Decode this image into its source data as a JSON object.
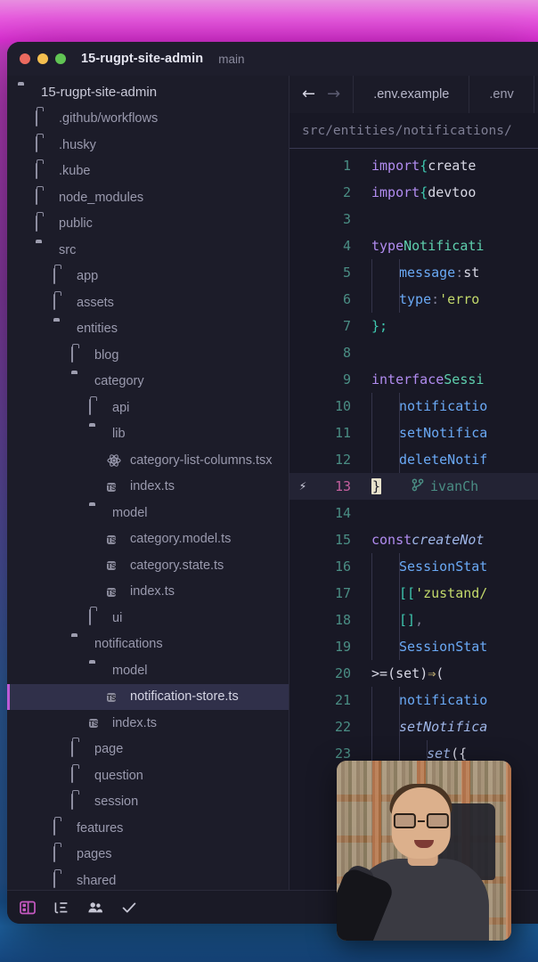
{
  "window": {
    "title": "15-rugpt-site-admin",
    "branch": "main",
    "traffic_lights": [
      "close",
      "minimize",
      "zoom"
    ]
  },
  "sidebar": {
    "items": [
      {
        "label": "15-rugpt-site-admin",
        "icon": "folder-open-icon",
        "depth": 0,
        "kind": "root",
        "selected": false
      },
      {
        "label": ".github/workflows",
        "icon": "folder-icon",
        "depth": 1,
        "kind": "folder",
        "selected": false
      },
      {
        "label": ".husky",
        "icon": "folder-icon",
        "depth": 1,
        "kind": "folder",
        "selected": false
      },
      {
        "label": ".kube",
        "icon": "folder-icon",
        "depth": 1,
        "kind": "folder",
        "selected": false
      },
      {
        "label": "node_modules",
        "icon": "folder-icon",
        "depth": 1,
        "kind": "folder",
        "selected": false
      },
      {
        "label": "public",
        "icon": "folder-icon",
        "depth": 1,
        "kind": "folder",
        "selected": false
      },
      {
        "label": "src",
        "icon": "folder-open-icon",
        "depth": 1,
        "kind": "folder-open",
        "selected": false
      },
      {
        "label": "app",
        "icon": "folder-icon",
        "depth": 2,
        "kind": "folder",
        "selected": false
      },
      {
        "label": "assets",
        "icon": "folder-icon",
        "depth": 2,
        "kind": "folder",
        "selected": false
      },
      {
        "label": "entities",
        "icon": "folder-open-icon",
        "depth": 2,
        "kind": "folder-open",
        "selected": false
      },
      {
        "label": "blog",
        "icon": "folder-icon",
        "depth": 3,
        "kind": "folder",
        "selected": false
      },
      {
        "label": "category",
        "icon": "folder-open-icon",
        "depth": 3,
        "kind": "folder-open",
        "selected": false
      },
      {
        "label": "api",
        "icon": "folder-icon",
        "depth": 4,
        "kind": "folder",
        "selected": false
      },
      {
        "label": "lib",
        "icon": "folder-open-icon",
        "depth": 4,
        "kind": "folder-open",
        "selected": false
      },
      {
        "label": "category-list-columns.tsx",
        "icon": "react-file-icon",
        "depth": 5,
        "kind": "tsx",
        "selected": false
      },
      {
        "label": "index.ts",
        "icon": "typescript-file-icon",
        "depth": 5,
        "kind": "ts",
        "selected": false
      },
      {
        "label": "model",
        "icon": "folder-open-icon",
        "depth": 4,
        "kind": "folder-open",
        "selected": false
      },
      {
        "label": "category.model.ts",
        "icon": "typescript-file-icon",
        "depth": 5,
        "kind": "ts",
        "selected": false
      },
      {
        "label": "category.state.ts",
        "icon": "typescript-file-icon",
        "depth": 5,
        "kind": "ts",
        "selected": false
      },
      {
        "label": "index.ts",
        "icon": "typescript-file-icon",
        "depth": 5,
        "kind": "ts",
        "selected": false
      },
      {
        "label": "ui",
        "icon": "folder-icon",
        "depth": 4,
        "kind": "folder",
        "selected": false
      },
      {
        "label": "notifications",
        "icon": "folder-open-icon",
        "depth": 3,
        "kind": "folder-open",
        "selected": false
      },
      {
        "label": "model",
        "icon": "folder-open-icon",
        "depth": 4,
        "kind": "folder-open",
        "selected": false
      },
      {
        "label": "notification-store.ts",
        "icon": "typescript-file-icon",
        "depth": 5,
        "kind": "ts",
        "selected": true
      },
      {
        "label": "index.ts",
        "icon": "typescript-file-icon",
        "depth": 4,
        "kind": "ts",
        "selected": false
      },
      {
        "label": "page",
        "icon": "folder-icon",
        "depth": 3,
        "kind": "folder",
        "selected": false
      },
      {
        "label": "question",
        "icon": "folder-icon",
        "depth": 3,
        "kind": "folder",
        "selected": false
      },
      {
        "label": "session",
        "icon": "folder-icon",
        "depth": 3,
        "kind": "folder",
        "selected": false
      },
      {
        "label": "features",
        "icon": "folder-icon",
        "depth": 2,
        "kind": "folder",
        "selected": false
      },
      {
        "label": "pages",
        "icon": "folder-icon",
        "depth": 2,
        "kind": "folder",
        "selected": false
      },
      {
        "label": "shared",
        "icon": "folder-icon",
        "depth": 2,
        "kind": "folder",
        "selected": false
      }
    ]
  },
  "statusbar": {
    "icons": [
      {
        "name": "toggle-sidebar-icon",
        "color": "#c659c2"
      },
      {
        "name": "outline-list-icon",
        "color": "#c6c6d4"
      },
      {
        "name": "collaborators-icon",
        "color": "#c6c6d4"
      },
      {
        "name": "checkmark-icon",
        "color": "#c6c6d4"
      }
    ]
  },
  "editor": {
    "nav": {
      "back": "←",
      "forward": "→"
    },
    "tabs": [
      {
        "label": ".env.example",
        "active": true
      },
      {
        "label": ".env",
        "active": false
      }
    ],
    "breadcrumb": "src/entities/notifications/",
    "active_line": 13,
    "cursor_char": "}",
    "blame": {
      "author": "ivanCh",
      "icon": "git-branch-icon"
    },
    "lines": [
      {
        "n": 1,
        "indent": 0,
        "tokens": [
          {
            "t": "import",
            "c": "kw"
          },
          {
            "t": " ",
            "c": "plain"
          },
          {
            "t": "{",
            "c": "brace"
          },
          {
            "t": " ",
            "c": "plain"
          },
          {
            "t": "create",
            "c": "plain"
          }
        ]
      },
      {
        "n": 2,
        "indent": 0,
        "tokens": [
          {
            "t": "import",
            "c": "kw"
          },
          {
            "t": " ",
            "c": "plain"
          },
          {
            "t": "{",
            "c": "brace"
          },
          {
            "t": " ",
            "c": "plain"
          },
          {
            "t": "devtoo",
            "c": "plain"
          }
        ]
      },
      {
        "n": 3,
        "indent": 0,
        "tokens": []
      },
      {
        "n": 4,
        "indent": 0,
        "tokens": [
          {
            "t": "type",
            "c": "kw"
          },
          {
            "t": " ",
            "c": "plain"
          },
          {
            "t": "Notificati",
            "c": "type"
          }
        ]
      },
      {
        "n": 5,
        "indent": 1,
        "tokens": [
          {
            "t": "message",
            "c": "prop"
          },
          {
            "t": ":",
            "c": "punct"
          },
          {
            "t": " st",
            "c": "plain"
          }
        ]
      },
      {
        "n": 6,
        "indent": 1,
        "tokens": [
          {
            "t": "type",
            "c": "prop"
          },
          {
            "t": ":",
            "c": "punct"
          },
          {
            "t": " ",
            "c": "plain"
          },
          {
            "t": "'erro",
            "c": "str"
          }
        ]
      },
      {
        "n": 7,
        "indent": 0,
        "tokens": [
          {
            "t": "};",
            "c": "brace"
          }
        ]
      },
      {
        "n": 8,
        "indent": 0,
        "tokens": []
      },
      {
        "n": 9,
        "indent": 0,
        "tokens": [
          {
            "t": "interface",
            "c": "kw"
          },
          {
            "t": " ",
            "c": "plain"
          },
          {
            "t": "Sessi",
            "c": "type"
          }
        ]
      },
      {
        "n": 10,
        "indent": 1,
        "tokens": [
          {
            "t": "notificatio",
            "c": "prop"
          }
        ]
      },
      {
        "n": 11,
        "indent": 1,
        "tokens": [
          {
            "t": "setNotifica",
            "c": "prop"
          }
        ]
      },
      {
        "n": 12,
        "indent": 1,
        "tokens": [
          {
            "t": "deleteNotif",
            "c": "prop"
          }
        ]
      },
      {
        "n": 13,
        "indent": 0,
        "tokens": [],
        "cursor": true,
        "blame": true
      },
      {
        "n": 14,
        "indent": 0,
        "tokens": []
      },
      {
        "n": 15,
        "indent": 0,
        "tokens": [
          {
            "t": "const",
            "c": "kw"
          },
          {
            "t": " ",
            "c": "plain"
          },
          {
            "t": "createNot",
            "c": "ital"
          }
        ]
      },
      {
        "n": 16,
        "indent": 1,
        "tokens": [
          {
            "t": "SessionStat",
            "c": "prop"
          }
        ]
      },
      {
        "n": 17,
        "indent": 1,
        "tokens": [
          {
            "t": "[[",
            "c": "brace"
          },
          {
            "t": "'zustand/",
            "c": "str"
          }
        ]
      },
      {
        "n": 18,
        "indent": 1,
        "tokens": [
          {
            "t": "[]",
            "c": "brace"
          },
          {
            "t": ",",
            "c": "punct"
          }
        ]
      },
      {
        "n": 19,
        "indent": 1,
        "tokens": [
          {
            "t": "SessionStat",
            "c": "prop"
          }
        ]
      },
      {
        "n": 20,
        "indent": 0,
        "tokens": [
          {
            "t": ">",
            "c": "plain"
          },
          {
            "t": " = ",
            "c": "plain"
          },
          {
            "t": "(",
            "c": "plain"
          },
          {
            "t": "set",
            "c": "plain"
          },
          {
            "t": ")",
            "c": "plain"
          },
          {
            "t": " ",
            "c": "plain"
          },
          {
            "t": "⇒",
            "c": "op"
          },
          {
            "t": " (",
            "c": "plain"
          }
        ]
      },
      {
        "n": 21,
        "indent": 1,
        "tokens": [
          {
            "t": "notificatio",
            "c": "prop"
          }
        ]
      },
      {
        "n": 22,
        "indent": 1,
        "tokens": [
          {
            "t": "setNotifica",
            "c": "ital"
          }
        ]
      },
      {
        "n": 23,
        "indent": 2,
        "tokens": [
          {
            "t": "set",
            "c": "ital"
          },
          {
            "t": "({",
            "c": "plain"
          }
        ]
      }
    ]
  },
  "webcam": {
    "label": "presenter-webcam-overlay"
  }
}
